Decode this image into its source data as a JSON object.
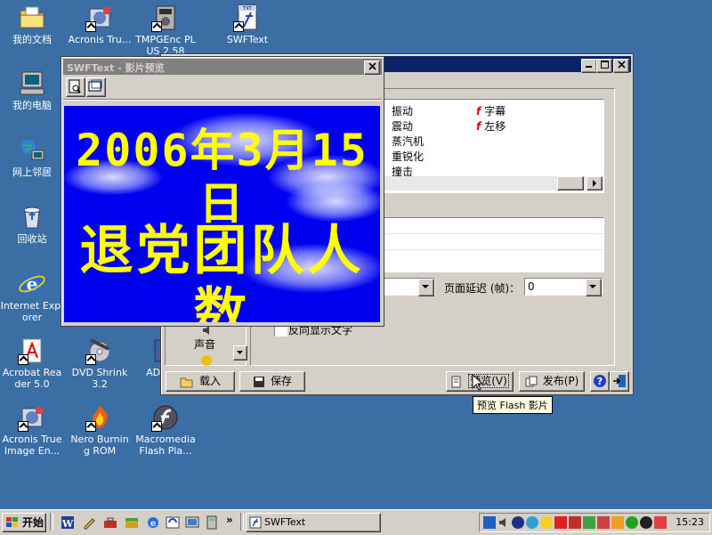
{
  "desktop_icons": [
    {
      "label": "我的文档",
      "icon": "my-documents-icon"
    },
    {
      "label": "Acronis Tru...",
      "icon": "acronis-icon"
    },
    {
      "label": "TMPGEnc PLUS 2.58",
      "icon": "tmpgenc-icon"
    },
    {
      "label": "SWFText",
      "icon": "swftext-file-icon"
    },
    {
      "label": "我的电脑",
      "icon": "my-computer-icon"
    },
    {
      "label": "网上邻居",
      "icon": "network-icon"
    },
    {
      "label": "回收站",
      "icon": "recycle-bin-icon"
    },
    {
      "label": "Internet Explorer",
      "icon": "ie-icon"
    },
    {
      "label": "Acrobat Reader 5.0",
      "icon": "acrobat-icon"
    },
    {
      "label": "DVD Shrink 3.2",
      "icon": "dvd-shrink-icon"
    },
    {
      "label": "AD SWF",
      "icon": "ad-swf-icon"
    },
    {
      "label": "Acronis True Image En...",
      "icon": "acronis-icon"
    },
    {
      "label": "Nero Burning ROM",
      "icon": "nero-icon"
    },
    {
      "label": "Macromedia Flash Pla...",
      "icon": "flash-player-icon"
    }
  ],
  "preview_window": {
    "title": "SWFText - 影片预览",
    "line1": "2006年3月15日",
    "line2": "退党团队人数"
  },
  "main_window": {
    "effects_col1": [
      "振动",
      "震动",
      "蒸汽机",
      "重锐化",
      "撞击"
    ],
    "effects_col2": [
      "字幕",
      "左移"
    ],
    "frame_delay_label": "页面延迟 (帧)：",
    "frame_delay_value": "0",
    "reverse_text_label": "反向显示文字",
    "sound_label": "声音",
    "load_label": "载入",
    "save_label": "保存",
    "preview_label": "预览(V)",
    "publish_label": "发布(P)",
    "tooltip": "预览 Flash 影片"
  },
  "taskbar": {
    "start_label": "开始",
    "task_label": "SWFText",
    "clock": "15:23",
    "overflow": "»"
  },
  "colors": {
    "desktop": "#3a6ea5",
    "preview_bg": "#0000f0",
    "preview_text": "#ffff00",
    "title_active": "#0a246a"
  }
}
